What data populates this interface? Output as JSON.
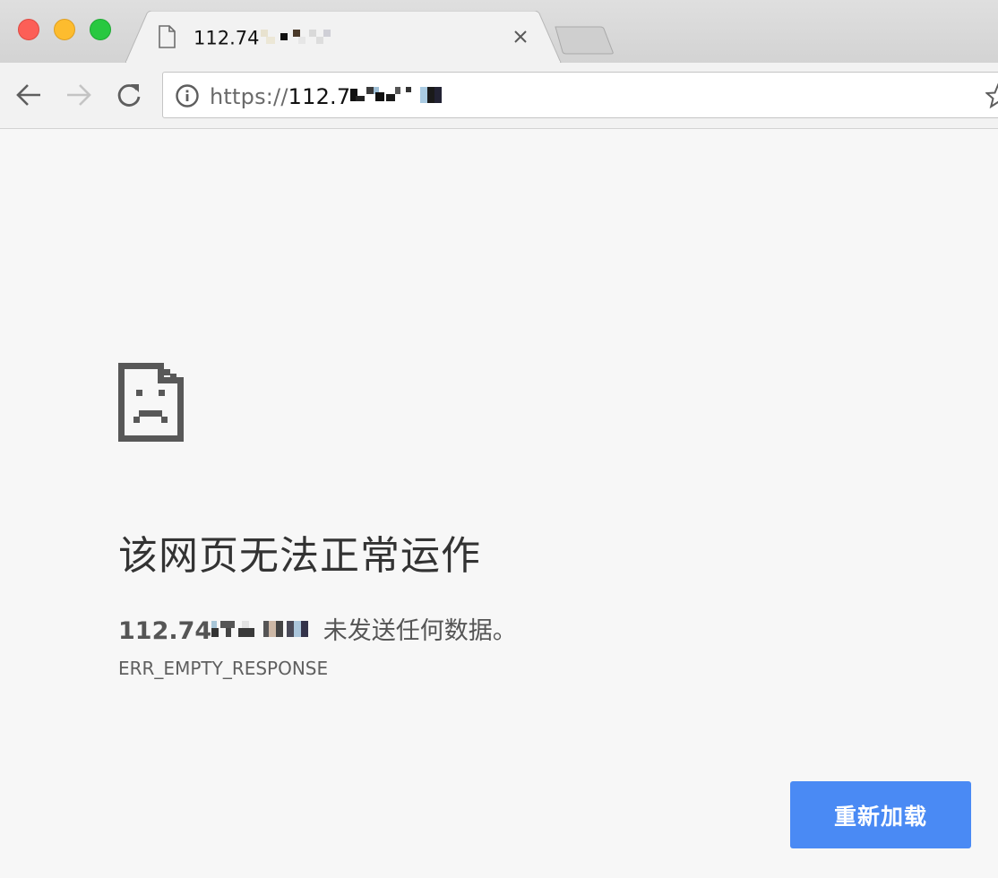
{
  "window": {
    "controls": [
      "close",
      "minimize",
      "maximize"
    ]
  },
  "tab": {
    "title_visible": "112.74",
    "icon": "page-icon",
    "close_icon": "close-icon"
  },
  "toolbar": {
    "back_icon": "arrow-left-icon",
    "forward_icon": "arrow-right-icon",
    "reload_icon": "reload-icon",
    "url_scheme": "https://",
    "url_host_visible": "112.7",
    "info_icon": "info-icon",
    "bookmark_icon": "star-icon"
  },
  "error": {
    "icon": "sad-page-icon",
    "heading": "该网页无法正常运作",
    "host_visible": "112.74",
    "message": " 未发送任何数据。",
    "code": "ERR_EMPTY_RESPONSE",
    "reload_label": "重新加载"
  },
  "colors": {
    "accent_button": "#4a8af4",
    "traffic_close": "#fc5f57",
    "traffic_minimize": "#fdbc2e",
    "traffic_maximize": "#28c840"
  }
}
